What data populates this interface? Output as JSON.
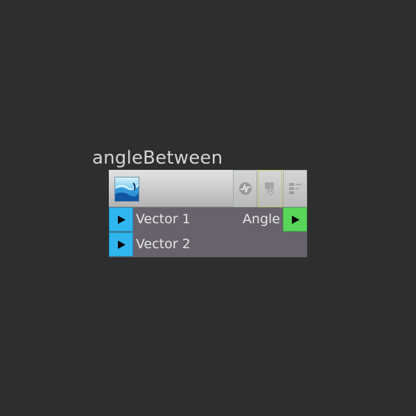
{
  "node": {
    "title": "angleBetween",
    "inputs": [
      {
        "label": "Vector 1",
        "color": "#2fb6ee"
      },
      {
        "label": "Vector 2",
        "color": "#2fb6ee"
      }
    ],
    "outputs": [
      {
        "label": "Angle",
        "color": "#59d65a"
      }
    ],
    "header_buttons": [
      {
        "icon": "wave-loop-icon"
      },
      {
        "icon": "node-download-icon"
      },
      {
        "icon": "node-list-icon"
      }
    ],
    "thumbnail_icon": "water-wave-icon"
  },
  "theme": {
    "canvas_bg": "#2e2e2e",
    "body_bg": "#67626b",
    "text": "#e6e6e6"
  }
}
